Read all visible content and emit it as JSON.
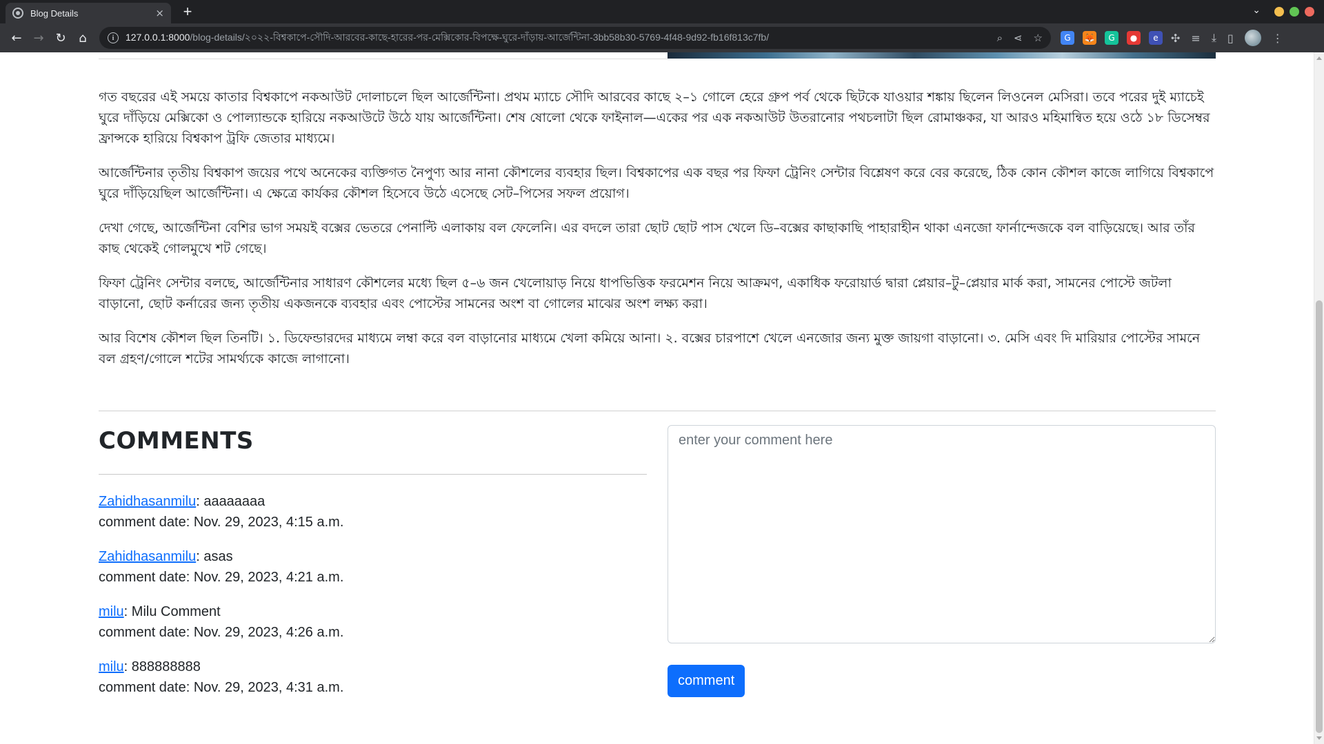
{
  "browser": {
    "tab_title": "Blog Details",
    "tab_close": "×",
    "new_tab": "+",
    "url_host": "127.0.0.1:8000",
    "url_path": "/blog-details/২০২২-বিশ্বকাপে-সৌদি-আরবের-কাছে-হারের-পর-মেক্সিকোর-বিপক্ষে-ঘুরে-দাঁড়ায়-আর্জেন্টিনা-3bb58b30-5769-4f48-9d92-fb16f813c7fb/",
    "window_controls_colors": [
      "#f4bf4f",
      "#61c554",
      "#ed6a5e"
    ],
    "extensions": [
      {
        "name": "translate-icon",
        "color": "#4285f4",
        "glyph": "G"
      },
      {
        "name": "metamask-icon",
        "color": "#f6851b",
        "glyph": "🦊"
      },
      {
        "name": "grammarly-icon",
        "color": "#15c39a",
        "glyph": "G"
      },
      {
        "name": "adblock-icon",
        "color": "#e53935",
        "glyph": "●"
      },
      {
        "name": "extension-blue-icon",
        "color": "#3f51b5",
        "glyph": "e"
      }
    ]
  },
  "article": {
    "paragraphs": [
      "গত বছরের এই সময়ে কাতার বিশ্বকাপে নকআউট দোলাচলে ছিল আর্জেন্টিনা। প্রথম ম্যাচে সৌদি আরবের কাছে ২–১ গোলে হেরে গ্রুপ পর্ব থেকে ছিটকে যাওয়ার শঙ্কায় ছিলেন লিওনেল মেসিরা। তবে পরের দুই ম্যাচেই ঘুরে দাঁড়িয়ে মেক্সিকো ও পোল্যান্ডকে হারিয়ে নকআউটে উঠে যায় আর্জেন্টিনা। শেষ ষোলো থেকে ফাইনাল—একের পর এক নকআউট উতরানোর পথচলাটা ছিল রোমাঞ্চকর, যা আরও মহিমান্বিত হয়ে ওঠে ১৮ ডিসেম্বর ফ্রান্সকে হারিয়ে বিশ্বকাপ ট্রফি জেতার মাধ্যমে।",
      "আর্জেন্টিনার তৃতীয় বিশ্বকাপ জয়ের পথে অনেকের ব্যক্তিগত নৈপুণ্য আর নানা কৌশলের ব্যবহার ছিল। বিশ্বকাপের এক বছর পর ফিফা ট্রেনিং সেন্টার বিশ্লেষণ করে বের করেছে, ঠিক কোন কৌশল কাজে লাগিয়ে বিশ্বকাপে ঘুরে দাঁড়িয়েছিল আর্জেন্টিনা। এ ক্ষেত্রে কার্যকর কৌশল হিসেবে উঠে এসেছে সেট–পিসের সফল প্রয়োগ।",
      "দেখা গেছে, আর্জেন্টিনা বেশির ভাগ সময়ই বক্সের ভেতরে পেনাল্টি এলাকায় বল ফেলেনি। এর বদলে তারা ছোট ছোট পাস খেলে ডি–বক্সের কাছাকাছি পাহারাহীন থাকা এনজো ফার্নান্দেজকে বল বাড়িয়েছে। আর তাঁর কাছ থেকেই গোলমুখে শট গেছে।",
      "ফিফা ট্রেনিং সেন্টার বলছে, আর্জেন্টিনার সাধারণ কৌশলের মধ্যে ছিল ৫–৬ জন খেলোয়াড় নিয়ে ধাপভিত্তিক ফরমেশন নিয়ে আক্রমণ, একাধিক ফরোয়ার্ড দ্বারা প্লেয়ার–টু–প্লেয়ার মার্ক করা, সামনের পোস্টে জটলা বাড়ানো, ছোট কর্নারের জন্য তৃতীয় একজনকে ব্যবহার এবং পোস্টের সামনের অংশ বা গোলের মাঝের অংশ লক্ষ্য করা।",
      "আর বিশেষ কৌশল ছিল তিনটি। ১. ডিফেন্ডারদের মাধ্যমে লম্বা করে বল বাড়ানোর মাধ্যমে খেলা কমিয়ে আনা। ২. বক্সের চারপাশে খেলে এনজোর জন্য মুক্ত জায়গা বাড়ানো। ৩. মেসি এবং দি মারিয়ার পোস্টের সামনে বল গ্রহণ/গোলে শটের সামর্থ্যকে কাজে লাগানো।"
    ]
  },
  "comments": {
    "title": "COMMENTS",
    "date_prefix": "comment date: ",
    "items": [
      {
        "user": "Zahidhasanmilu",
        "text": ": aaaaaaaa",
        "date": "Nov. 29, 2023, 4:15 a.m."
      },
      {
        "user": "Zahidhasanmilu",
        "text": ": asas",
        "date": "Nov. 29, 2023, 4:21 a.m."
      },
      {
        "user": "milu",
        "text": ": Milu Comment",
        "date": "Nov. 29, 2023, 4:26 a.m."
      },
      {
        "user": "milu",
        "text": ": 888888888",
        "date": "Nov. 29, 2023, 4:31 a.m."
      }
    ]
  },
  "form": {
    "textarea_placeholder": "enter your comment here",
    "textarea_value": "",
    "submit_label": "comment",
    "accent_color": "#0d6efd"
  }
}
